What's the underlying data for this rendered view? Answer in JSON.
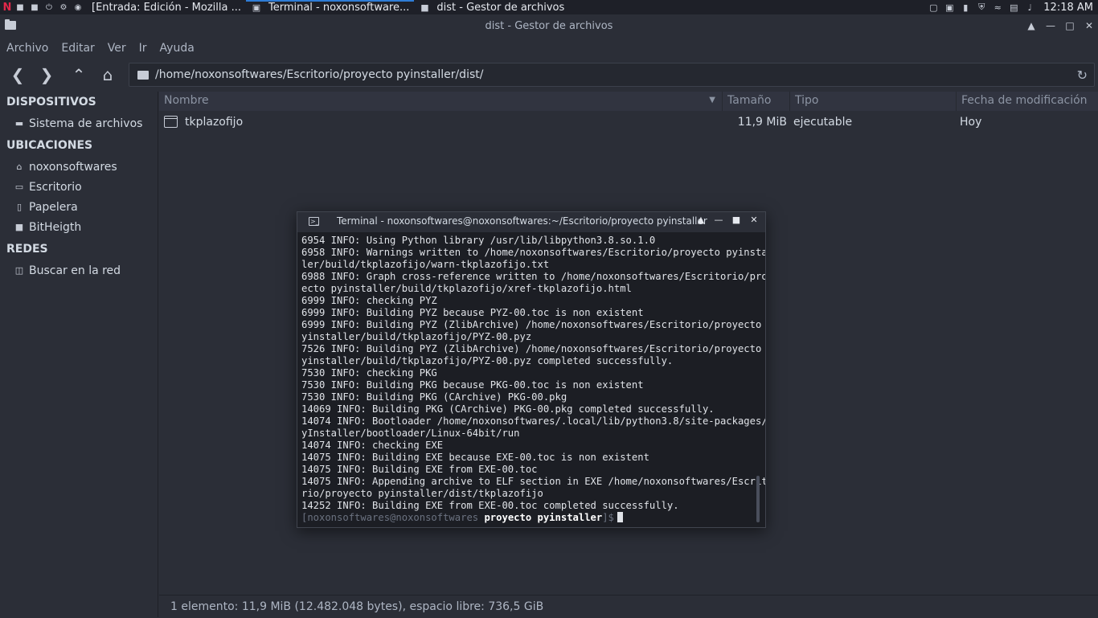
{
  "panel": {
    "launcher": "N",
    "tasks": [
      {
        "label": "[Entrada: Edición - Mozilla ..."
      },
      {
        "label": "Terminal - noxonsoftware..."
      },
      {
        "label": "dist - Gestor de archivos"
      }
    ],
    "clock": "12:18 AM"
  },
  "window": {
    "title": "dist - Gestor de archivos"
  },
  "menubar": {
    "items": [
      "Archivo",
      "Editar",
      "Ver",
      "Ir",
      "Ayuda"
    ]
  },
  "toolbar": {
    "path": "/home/noxonsoftwares/Escritorio/proyecto pyinstaller/dist/"
  },
  "sidebar": {
    "devices_heading": "DISPOSITIVOS",
    "devices": [
      {
        "label": "Sistema de archivos",
        "icon": "drive-icon"
      }
    ],
    "places_heading": "UBICACIONES",
    "places": [
      {
        "label": "noxonsoftwares",
        "icon": "home-icon"
      },
      {
        "label": "Escritorio",
        "icon": "desktop-icon"
      },
      {
        "label": "Papelera",
        "icon": "trash-icon"
      },
      {
        "label": "BitHeigth",
        "icon": "folder-icon"
      }
    ],
    "network_heading": "REDES",
    "network": [
      {
        "label": "Buscar en la red",
        "icon": "network-icon"
      }
    ]
  },
  "files": {
    "columns": {
      "name": "Nombre",
      "size": "Tamaño",
      "type": "Tipo",
      "modified": "Fecha de modificación"
    },
    "rows": [
      {
        "name": "tkplazofijo",
        "size": "11,9 MiB",
        "type": "ejecutable",
        "modified": "Hoy"
      }
    ]
  },
  "statusbar": {
    "text": "1 elemento: 11,9 MiB (12.482.048 bytes), espacio libre: 736,5 GiB"
  },
  "terminal": {
    "title": "Terminal - noxonsoftwares@noxonsoftwares:~/Escritorio/proyecto pyinstaller",
    "lines": [
      "6954 INFO: Using Python library /usr/lib/libpython3.8.so.1.0",
      "6958 INFO: Warnings written to /home/noxonsoftwares/Escritorio/proyecto pyinstal",
      "ler/build/tkplazofijo/warn-tkplazofijo.txt",
      "6988 INFO: Graph cross-reference written to /home/noxonsoftwares/Escritorio/proy",
      "ecto pyinstaller/build/tkplazofijo/xref-tkplazofijo.html",
      "6999 INFO: checking PYZ",
      "6999 INFO: Building PYZ because PYZ-00.toc is non existent",
      "6999 INFO: Building PYZ (ZlibArchive) /home/noxonsoftwares/Escritorio/proyecto p",
      "yinstaller/build/tkplazofijo/PYZ-00.pyz",
      "7526 INFO: Building PYZ (ZlibArchive) /home/noxonsoftwares/Escritorio/proyecto p",
      "yinstaller/build/tkplazofijo/PYZ-00.pyz completed successfully.",
      "7530 INFO: checking PKG",
      "7530 INFO: Building PKG because PKG-00.toc is non existent",
      "7530 INFO: Building PKG (CArchive) PKG-00.pkg",
      "14069 INFO: Building PKG (CArchive) PKG-00.pkg completed successfully.",
      "14074 INFO: Bootloader /home/noxonsoftwares/.local/lib/python3.8/site-packages/P",
      "yInstaller/bootloader/Linux-64bit/run",
      "14074 INFO: checking EXE",
      "14075 INFO: Building EXE because EXE-00.toc is non existent",
      "14075 INFO: Building EXE from EXE-00.toc",
      "14075 INFO: Appending archive to ELF section in EXE /home/noxonsoftwares/Escrito",
      "rio/proyecto pyinstaller/dist/tkplazofijo",
      "14252 INFO: Building EXE from EXE-00.toc completed successfully."
    ],
    "prompt_user": "[noxonsoftwares@noxonsoftwares",
    "prompt_dir": "proyecto pyinstaller",
    "prompt_end": "]$"
  }
}
